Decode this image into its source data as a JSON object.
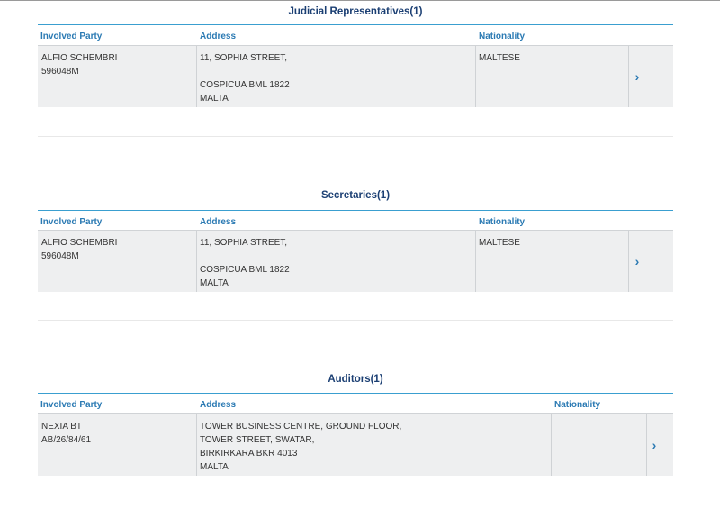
{
  "sections": [
    {
      "title": "Judicial Representatives(1)",
      "headers": {
        "party": "Involved Party",
        "address": "Address",
        "nationality": "Nationality"
      },
      "row": {
        "party_line1": "ALFIO SCHEMBRI",
        "party_line2": "596048M",
        "address_lines": [
          "11, SOPHIA STREET,",
          "",
          "COSPICUA BML 1822",
          "MALTA"
        ],
        "nationality": "MALTESE"
      }
    },
    {
      "title": "Secretaries(1)",
      "headers": {
        "party": "Involved Party",
        "address": "Address",
        "nationality": "Nationality"
      },
      "row": {
        "party_line1": "ALFIO SCHEMBRI",
        "party_line2": "596048M",
        "address_lines": [
          "11, SOPHIA STREET,",
          "",
          "COSPICUA BML 1822",
          "MALTA"
        ],
        "nationality": "MALTESE"
      }
    },
    {
      "title": "Auditors(1)",
      "headers": {
        "party": "Involved Party",
        "address": "Address",
        "nationality": "Nationality"
      },
      "row": {
        "party_line1": "NEXIA BT",
        "party_line2": "AB/26/84/61",
        "address_lines": [
          "TOWER BUSINESS CENTRE, GROUND FLOOR,",
          "TOWER STREET, SWATAR,",
          "BIRKIRKARA BKR 4013",
          "MALTA"
        ],
        "nationality": ""
      }
    }
  ],
  "icons": {
    "row_expand": "chevron-right-icon"
  },
  "colors": {
    "title": "#1b3f73",
    "header_text": "#2b7ab3",
    "header_line": "#3a9fd0",
    "row_bg": "#eeeff0"
  }
}
